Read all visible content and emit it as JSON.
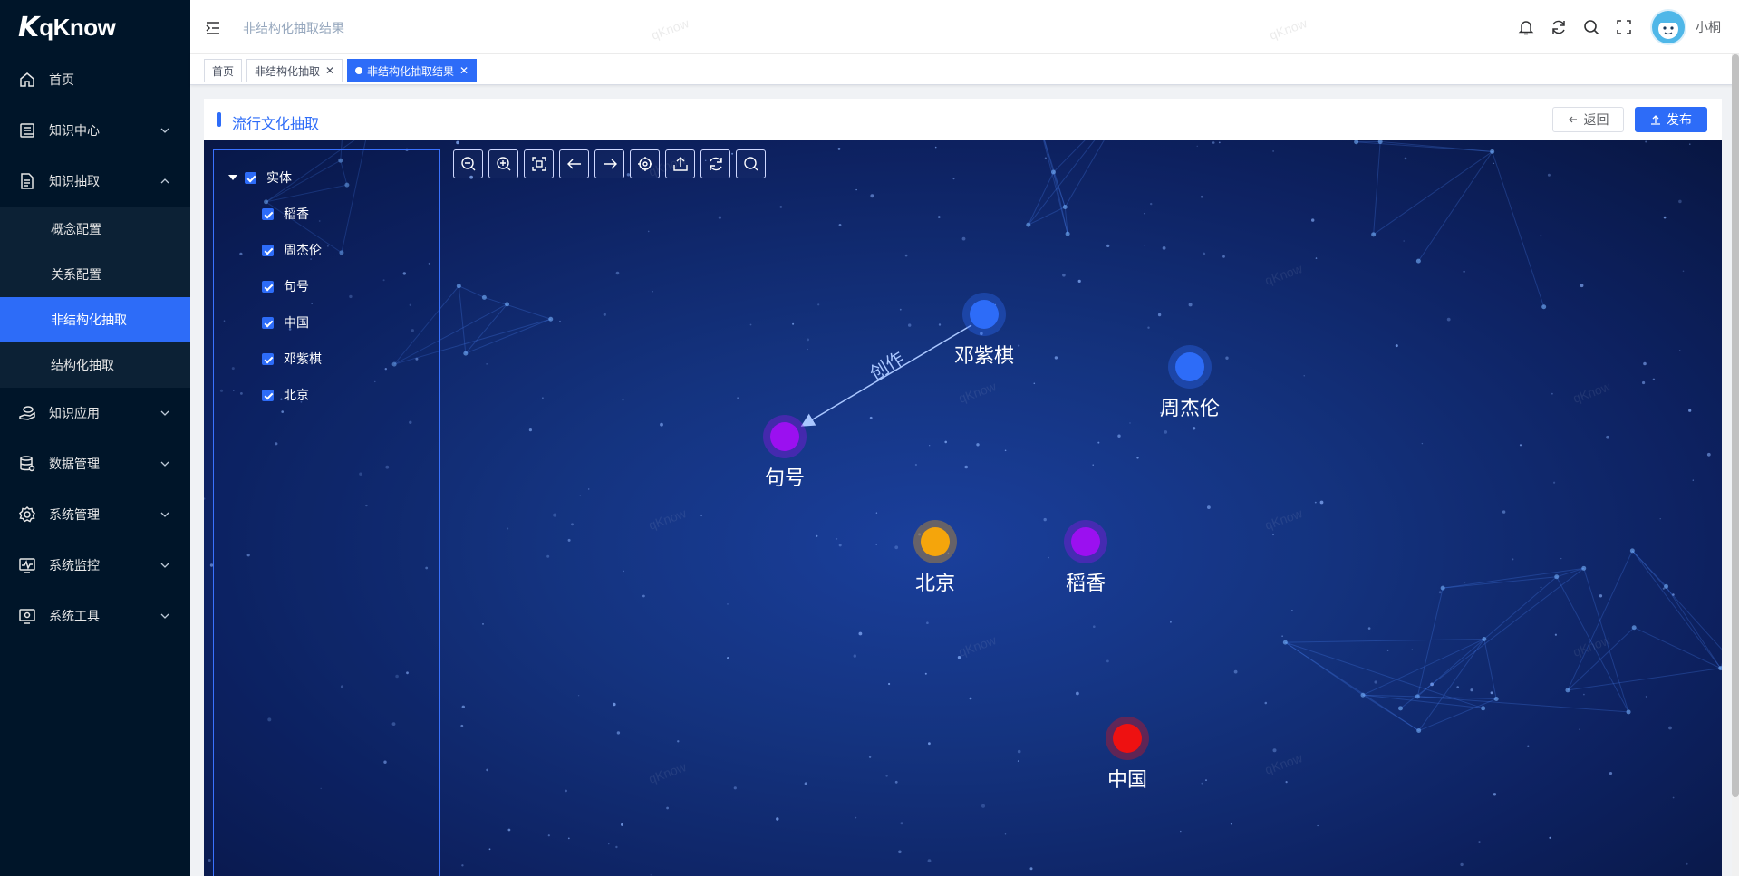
{
  "app": {
    "logo_mark": "K",
    "logo_text": "qKnow"
  },
  "sidebar": {
    "items": [
      {
        "label": "首页",
        "icon": "home-icon"
      },
      {
        "label": "知识中心",
        "icon": "book-icon"
      },
      {
        "label": "知识抽取",
        "icon": "document-icon",
        "expanded": true,
        "children": [
          {
            "label": "概念配置"
          },
          {
            "label": "关系配置"
          },
          {
            "label": "非结构化抽取",
            "active": true
          },
          {
            "label": "结构化抽取"
          }
        ]
      },
      {
        "label": "知识应用",
        "icon": "hand-icon"
      },
      {
        "label": "数据管理",
        "icon": "database-icon"
      },
      {
        "label": "系统管理",
        "icon": "gear-icon"
      },
      {
        "label": "系统监控",
        "icon": "monitor-icon"
      },
      {
        "label": "系统工具",
        "icon": "tool-icon"
      }
    ]
  },
  "header": {
    "breadcrumb": "非结构化抽取结果",
    "username": "小桐"
  },
  "tags": [
    {
      "label": "首页"
    },
    {
      "label": "非结构化抽取",
      "close": "✕"
    },
    {
      "label": "非结构化抽取结果",
      "close": "✕",
      "active": true
    }
  ],
  "card": {
    "title": "流行文化抽取",
    "back_label": "返回",
    "publish_label": "发布"
  },
  "tree": {
    "root": "实体",
    "children": [
      "稻香",
      "周杰伦",
      "句号",
      "中国",
      "邓紫棋",
      "北京"
    ]
  },
  "toolbar": [
    "zoom-out-icon",
    "zoom-in-icon",
    "fit-view-icon",
    "undo-icon",
    "redo-icon",
    "locate-icon",
    "export-icon",
    "refresh-icon",
    "search-icon"
  ],
  "graph": {
    "nodes": [
      {
        "label": "邓紫棋",
        "color": "#2d6cf8"
      },
      {
        "label": "周杰伦",
        "color": "#2d6cf8"
      },
      {
        "label": "句号",
        "color": "#9b10f0"
      },
      {
        "label": "北京",
        "color": "#f5a50b"
      },
      {
        "label": "稻香",
        "color": "#9b10f0"
      },
      {
        "label": "中国",
        "color": "#ee1111"
      }
    ],
    "edges": [
      {
        "from": "邓紫棋",
        "to": "句号",
        "label": "创作"
      }
    ]
  },
  "watermark": "qKnow"
}
